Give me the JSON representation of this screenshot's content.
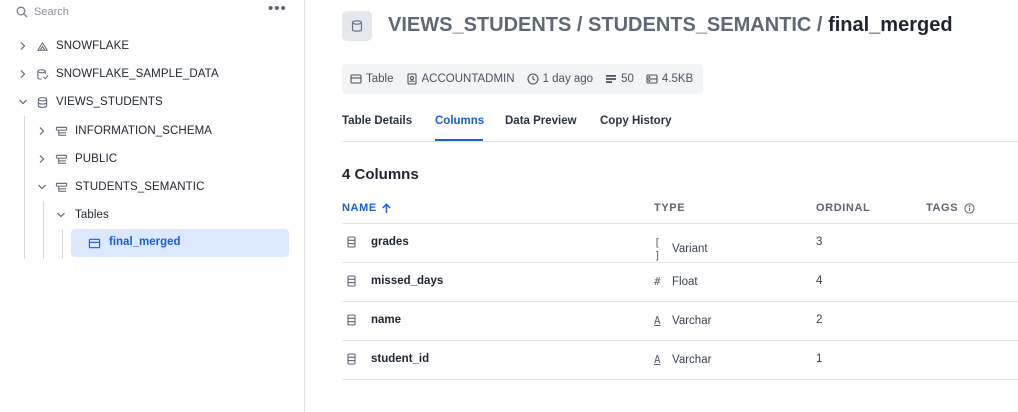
{
  "sidebar": {
    "search_placeholder": "Search",
    "more_label": "•••",
    "tree": [
      {
        "label": "SNOWFLAKE",
        "icon": "database-share-icon",
        "expanded": false
      },
      {
        "label": "SNOWFLAKE_SAMPLE_DATA",
        "icon": "database-shared-icon",
        "expanded": false
      },
      {
        "label": "VIEWS_STUDENTS",
        "icon": "database-icon",
        "expanded": true
      },
      {
        "label": "INFORMATION_SCHEMA",
        "icon": "schema-icon",
        "expanded": false
      },
      {
        "label": "PUBLIC",
        "icon": "schema-icon",
        "expanded": false
      },
      {
        "label": "STUDENTS_SEMANTIC",
        "icon": "schema-icon",
        "expanded": true
      },
      {
        "label": "Tables",
        "expanded": true
      },
      {
        "label": "final_merged",
        "icon": "table-icon",
        "selected": true
      }
    ]
  },
  "header": {
    "path": "VIEWS_STUDENTS / STUDENTS_SEMANTIC / ",
    "object_name": "final_merged"
  },
  "meta": {
    "type": "Table",
    "owner": "ACCOUNTADMIN",
    "age": "1 day ago",
    "rows": "50",
    "size": "4.5KB"
  },
  "tabs": [
    {
      "label": "Table Details",
      "active": false
    },
    {
      "label": "Columns",
      "active": true
    },
    {
      "label": "Data Preview",
      "active": false
    },
    {
      "label": "Copy History",
      "active": false
    }
  ],
  "columns_section": {
    "count_label": "4 Columns",
    "headers": {
      "name": "NAME",
      "type": "TYPE",
      "ordinal": "ORDINAL",
      "tags": "TAGS"
    },
    "rows": [
      {
        "name": "grades",
        "type_glyph": "[ ]",
        "type": "Variant",
        "ordinal": "3"
      },
      {
        "name": "missed_days",
        "type_glyph": "#",
        "type": "Float",
        "ordinal": "4"
      },
      {
        "name": "name",
        "type_glyph": "A",
        "type": "Varchar",
        "ordinal": "2"
      },
      {
        "name": "student_id",
        "type_glyph": "A",
        "type": "Varchar",
        "ordinal": "1"
      }
    ]
  },
  "colors": {
    "accent": "#1a5ed8",
    "selected_bg": "#dce8ff",
    "text": "#1e252f",
    "muted": "#5d6471"
  }
}
